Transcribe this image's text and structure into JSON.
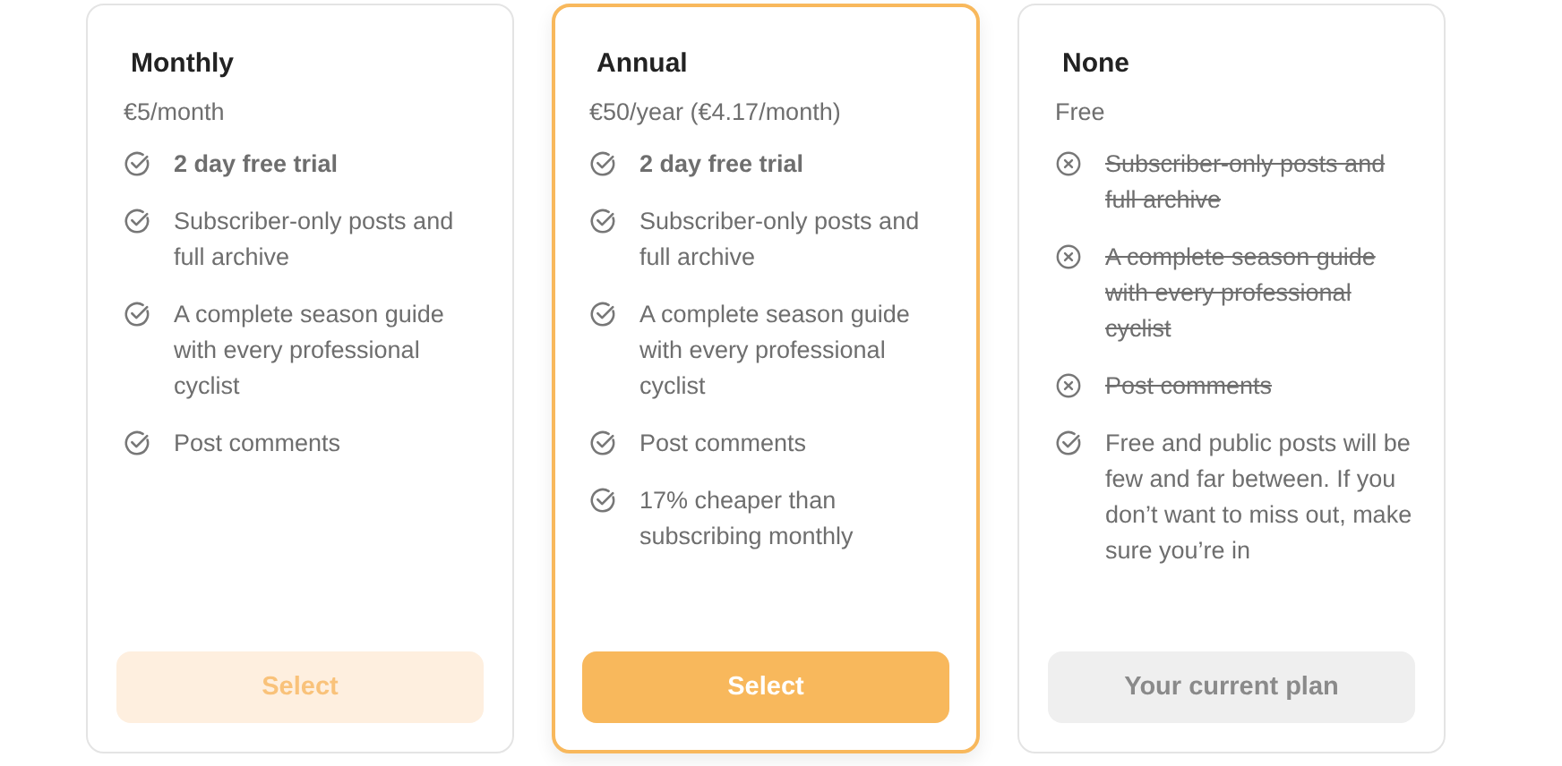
{
  "plans": [
    {
      "name": "Monthly",
      "price": "€5/month",
      "selected": false,
      "current": false,
      "button": "Select",
      "features": [
        {
          "text": "2 day free trial",
          "included": true,
          "highlighted": true
        },
        {
          "text": "Subscriber-only posts and full archive",
          "included": true,
          "highlighted": false
        },
        {
          "text": "A complete season guide with every professional cyclist",
          "included": true,
          "highlighted": false
        },
        {
          "text": "Post comments",
          "included": true,
          "highlighted": false
        }
      ]
    },
    {
      "name": "Annual",
      "price": "€50/year (€4.17/month)",
      "selected": true,
      "current": false,
      "button": "Select",
      "features": [
        {
          "text": "2 day free trial",
          "included": true,
          "highlighted": true
        },
        {
          "text": "Subscriber-only posts and full archive",
          "included": true,
          "highlighted": false
        },
        {
          "text": "A complete season guide with every professional cyclist",
          "included": true,
          "highlighted": false
        },
        {
          "text": "Post comments",
          "included": true,
          "highlighted": false
        },
        {
          "text": "17% cheaper than subscribing monthly",
          "included": true,
          "highlighted": false
        }
      ]
    },
    {
      "name": "None",
      "price": "Free",
      "selected": false,
      "current": true,
      "button": "Your current plan",
      "features": [
        {
          "text": "Subscriber-only posts and full archive",
          "included": false,
          "highlighted": false
        },
        {
          "text": "A complete season guide with every professional cyclist",
          "included": false,
          "highlighted": false
        },
        {
          "text": "Post comments",
          "included": false,
          "highlighted": false
        },
        {
          "text": "Free and public posts will be few and far between. If you don’t want to miss out, make sure you’re in",
          "included": true,
          "highlighted": false
        }
      ]
    }
  ]
}
